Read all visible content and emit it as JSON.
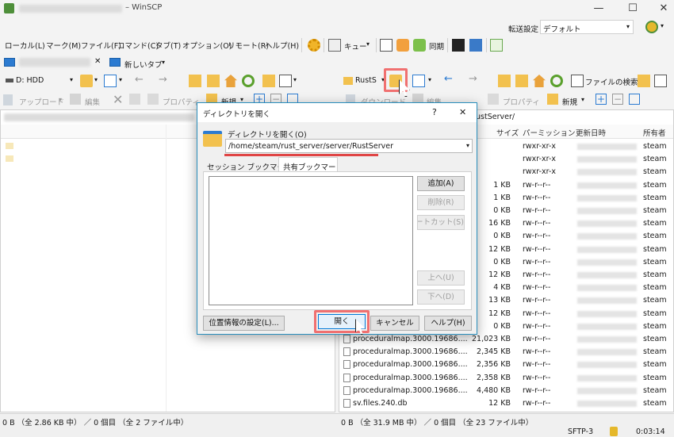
{
  "window": {
    "title": "– WinSCP",
    "minimize": "—",
    "maximize": "☐",
    "close": "✕"
  },
  "transfer": {
    "label": "転送設定",
    "value": "デフォルト"
  },
  "menu": [
    "ローカル(L)",
    "マーク(M)",
    "ファイル(F)",
    "コマンド(C)",
    "タブ(T)",
    "オプション(O)",
    "リモート(R)",
    "ヘルプ(H)"
  ],
  "toolbar": {
    "queue": "キュー",
    "sync": "同期"
  },
  "tabs": {
    "new_tab": "新しいタブ"
  },
  "local": {
    "drive": "D: HDD",
    "upload": "アップロード",
    "edit": "編集",
    "properties": "プロパティ",
    "new": "新規"
  },
  "remote": {
    "location": "RustS",
    "find_files": "ファイルの検索",
    "download": "ダウンロード",
    "edit": "編集",
    "properties": "プロパティ",
    "new": "新規",
    "path_tail": "ustServer/",
    "columns": {
      "size": "サイズ",
      "perm": "パーミッション",
      "modified": "更新日時",
      "owner": "所有者"
    },
    "rows": [
      {
        "name": "",
        "size": "",
        "perm": "rwxr-xr-x",
        "owner": "steam"
      },
      {
        "name": "",
        "size": "",
        "perm": "rwxr-xr-x",
        "owner": "steam"
      },
      {
        "name": "",
        "size": "",
        "perm": "rwxr-xr-x",
        "owner": "steam"
      },
      {
        "name": "",
        "size": "1 KB",
        "perm": "rw-r--r--",
        "owner": "steam"
      },
      {
        "name": "",
        "size": "1 KB",
        "perm": "rw-r--r--",
        "owner": "steam"
      },
      {
        "name": "",
        "size": "0 KB",
        "perm": "rw-r--r--",
        "owner": "steam"
      },
      {
        "name": "",
        "size": "16 KB",
        "perm": "rw-r--r--",
        "owner": "steam"
      },
      {
        "name": "",
        "size": "0 KB",
        "perm": "rw-r--r--",
        "owner": "steam"
      },
      {
        "name": "",
        "size": "12 KB",
        "perm": "rw-r--r--",
        "owner": "steam"
      },
      {
        "name": "",
        "size": "0 KB",
        "perm": "rw-r--r--",
        "owner": "steam"
      },
      {
        "name": "",
        "size": "12 KB",
        "perm": "rw-r--r--",
        "owner": "steam"
      },
      {
        "name": "",
        "size": "4 KB",
        "perm": "rw-r--r--",
        "owner": "steam"
      },
      {
        "name": "",
        "size": "13 KB",
        "perm": "rw-r--r--",
        "owner": "steam"
      },
      {
        "name": "",
        "size": "12 KB",
        "perm": "rw-r--r--",
        "owner": "steam"
      },
      {
        "name": "",
        "size": "0 KB",
        "perm": "rw-r--r--",
        "owner": "steam"
      },
      {
        "name": "proceduralmap.3000.19686....",
        "size": "21,023 KB",
        "perm": "rw-r--r--",
        "owner": "steam"
      },
      {
        "name": "proceduralmap.3000.19686....",
        "size": "2,345 KB",
        "perm": "rw-r--r--",
        "owner": "steam"
      },
      {
        "name": "proceduralmap.3000.19686....",
        "size": "2,356 KB",
        "perm": "rw-r--r--",
        "owner": "steam"
      },
      {
        "name": "proceduralmap.3000.19686....",
        "size": "2,358 KB",
        "perm": "rw-r--r--",
        "owner": "steam"
      },
      {
        "name": "proceduralmap.3000.19686....",
        "size": "4,480 KB",
        "perm": "rw-r--r--",
        "owner": "steam"
      },
      {
        "name": "sv.files.240.db",
        "size": "12 KB",
        "perm": "rw-r--r--",
        "owner": "steam"
      }
    ]
  },
  "status": {
    "left": "0 B （全 2.86 KB 中） ／ 0 個目 （全 2 ファイル中）",
    "right": "0 B （全 31.9 MB 中） ／ 0 個目 （全 23 ファイル中）",
    "protocol": "SFTP-3",
    "time": "0:03:14"
  },
  "dialog": {
    "title": "ディレクトリを開く",
    "help": "?",
    "close": "✕",
    "label": "ディレクトリを開く(O)",
    "path": "/home/steam/rust_server/server/RustServer",
    "tab_session": "セッション ブックマーク",
    "tab_shared": "共有ブックマーク",
    "btn_add": "追加(A)",
    "btn_delete": "削除(R)",
    "btn_shortcut": "ショートカット(S)...",
    "btn_up": "上へ(U)",
    "btn_down": "下へ(D)",
    "btn_location": "位置情報の設定(L)...",
    "btn_open": "開く",
    "btn_cancel": "キャンセル",
    "btn_help": "ヘルプ(H)"
  },
  "colors": {
    "accent": "#2a8fbd",
    "highlight": "#f07070",
    "folder": "#f2c14e"
  }
}
